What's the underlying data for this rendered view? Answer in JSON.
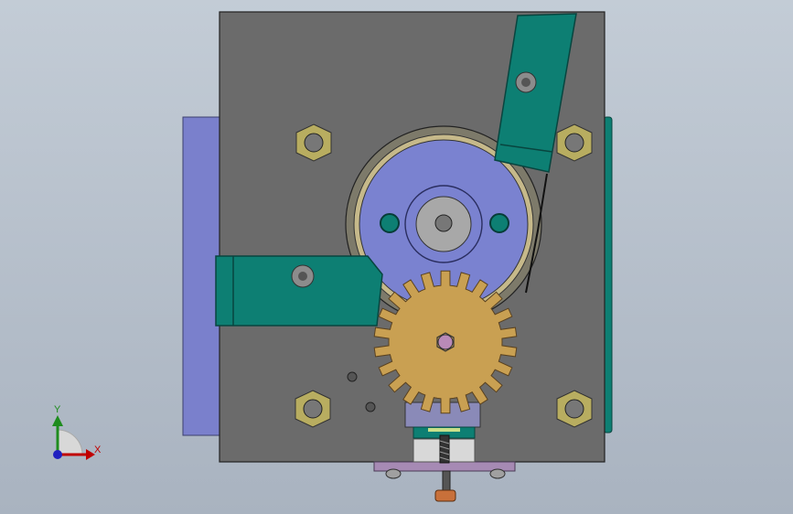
{
  "viewport": {
    "background_top": "#c3ccd6",
    "background_bottom": "#a9b3c0"
  },
  "colors": {
    "plate": "#6b6b6b",
    "side_block": "#7a80cc",
    "green_part": "#0d7f73",
    "gear": "#c9a052",
    "bearing_blue": "#7a82d0",
    "hex_nut": "#b8ad60",
    "bottom_bar": "#a68ab4",
    "copper": "#c8703a"
  },
  "triad": {
    "y_label": "Y",
    "x_label": "X"
  }
}
